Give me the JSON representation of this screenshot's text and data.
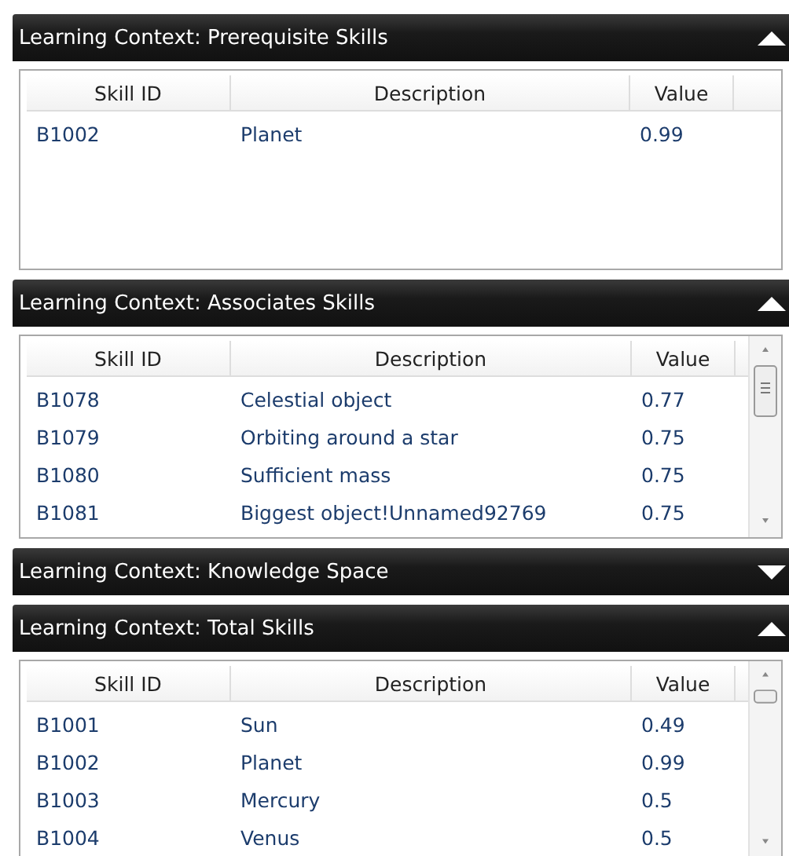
{
  "panels": [
    {
      "title": "Learning Context: Prerequisite Skills",
      "expanded": true,
      "scrollable": false,
      "columns": [
        "Skill ID",
        "Description",
        "Value"
      ],
      "rows": [
        [
          "B1002",
          "Planet",
          "0.99"
        ]
      ]
    },
    {
      "title": "Learning Context: Associates Skills",
      "expanded": true,
      "scrollable": true,
      "columns": [
        "Skill ID",
        "Description",
        "Value"
      ],
      "rows": [
        [
          "B1078",
          "Celestial object",
          "0.77"
        ],
        [
          "B1079",
          "Orbiting around a star",
          "0.75"
        ],
        [
          "B1080",
          "Sufficient mass",
          "0.75"
        ],
        [
          "B1081",
          "Biggest object!Unnamed92769",
          "0.75"
        ]
      ]
    },
    {
      "title": "Learning Context: Knowledge Space",
      "expanded": false
    },
    {
      "title": "Learning Context: Total Skills",
      "expanded": true,
      "scrollable": true,
      "columns": [
        "Skill ID",
        "Description",
        "Value"
      ],
      "rows": [
        [
          "B1001",
          "Sun",
          "0.49"
        ],
        [
          "B1002",
          "Planet",
          "0.99"
        ],
        [
          "B1003",
          "Mercury",
          "0.5"
        ],
        [
          "B1004",
          "Venus",
          "0.5"
        ]
      ]
    }
  ]
}
